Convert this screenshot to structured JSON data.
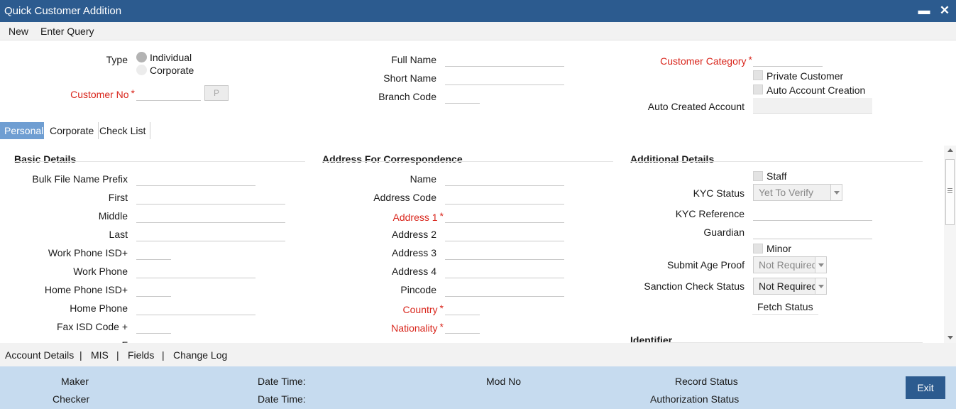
{
  "window": {
    "title": "Quick Customer Addition",
    "minimize": "▬",
    "close": "✕"
  },
  "menu": {
    "new": "New",
    "enter_query": "Enter Query"
  },
  "header": {
    "type_label": "Type",
    "type_individual": "Individual",
    "type_corporate": "Corporate",
    "customer_no_label": "Customer No",
    "customer_no_value": "",
    "p_button": "P",
    "full_name_label": "Full Name",
    "short_name_label": "Short Name",
    "branch_code_label": "Branch Code",
    "customer_category_label": "Customer Category",
    "private_customer_label": "Private Customer",
    "auto_account_creation_label": "Auto Account Creation",
    "auto_created_account_label": "Auto Created Account",
    "required_mark": "*"
  },
  "tabs": {
    "personal": "Personal",
    "corporate": "Corporate",
    "check_list": "Check List"
  },
  "basic": {
    "title": "Basic Details",
    "bulk_file_name_prefix": "Bulk File Name Prefix",
    "first": "First",
    "middle": "Middle",
    "last": "Last",
    "work_phone_isd": "Work Phone ISD+",
    "work_phone": "Work Phone",
    "home_phone_isd": "Home Phone ISD+",
    "home_phone": "Home Phone",
    "fax_isd_code": "Fax ISD Code +",
    "partial": "F"
  },
  "address": {
    "title": "Address For Correspondence",
    "name": "Name",
    "address_code": "Address Code",
    "address1": "Address 1",
    "address2": "Address 2",
    "address3": "Address 3",
    "address4": "Address 4",
    "pincode": "Pincode",
    "country": "Country",
    "nationality": "Nationality"
  },
  "additional": {
    "title": "Additional Details",
    "staff": "Staff",
    "kyc_status_label": "KYC Status",
    "kyc_status_value": "Yet To Verify",
    "kyc_reference_label": "KYC Reference",
    "guardian_label": "Guardian",
    "minor": "Minor",
    "submit_age_proof_label": "Submit Age Proof",
    "submit_age_proof_value": "Not Required",
    "sanction_check_status_label": "Sanction Check Status",
    "sanction_check_status_value": "Not Required",
    "fetch_status": "Fetch Status",
    "identifier_title": "Identifier"
  },
  "bottom_links": {
    "account_details": "Account Details",
    "mis": "MIS",
    "fields": "Fields",
    "change_log": "Change Log",
    "separator": "|"
  },
  "footer": {
    "maker": "Maker",
    "checker": "Checker",
    "date_time": "Date Time:",
    "mod_no": "Mod No",
    "record_status": "Record Status",
    "authorization_status": "Authorization Status",
    "exit": "Exit"
  },
  "colors": {
    "title_bar": "#2c5b8f",
    "required": "#d9261c",
    "active_tab": "#6f9ed2",
    "footer": "#c6dbef"
  }
}
